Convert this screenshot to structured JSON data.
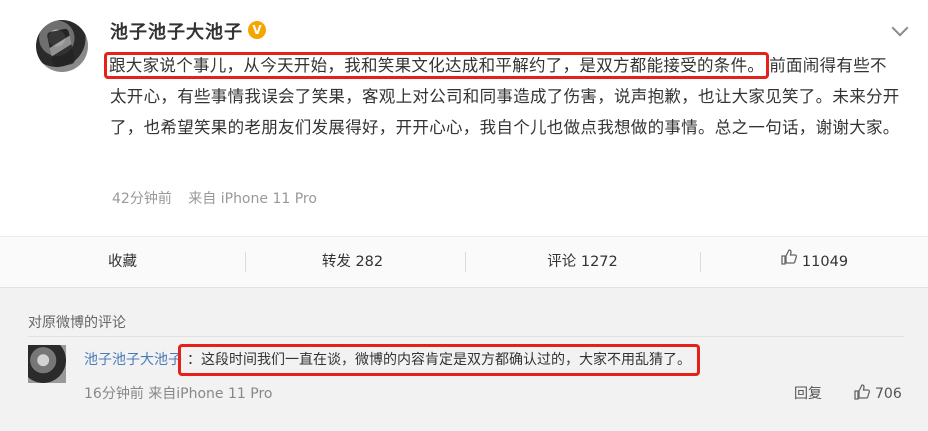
{
  "post": {
    "username": "池子池子大池子",
    "verified_badge": "V",
    "content_highlight": "跟大家说个事儿，从今天开始，我和笑果文化达成和平解约了，是双方都能接受的条件。",
    "content_rest": "前面闹得有些不太开心，有些事情我误会了笑果，客观上对公司和同事造成了伤害，说声抱歉，也让大家见笑了。未来分开了，也希望笑果的老朋友们发展得好，开开心心，我自个儿也做点我想做的事情。总之一句话，谢谢大家。",
    "time": "42分钟前",
    "source": "来自 iPhone 11 Pro",
    "accent_color": "#e5211b"
  },
  "actions": {
    "favorite": "收藏",
    "repost": "转发 282",
    "comment": "评论 1272",
    "like_count": "11049"
  },
  "comments": {
    "heading": "对原微博的评论",
    "items": [
      {
        "username": "池子池子大池子",
        "separator": "：",
        "text": "这段时间我们一直在谈，微博的内容肯定是双方都确认过的，大家不用乱猜了。",
        "time": "16分钟前",
        "source": "来自iPhone 11 Pro",
        "reply": "回复",
        "likes": "706"
      }
    ]
  }
}
